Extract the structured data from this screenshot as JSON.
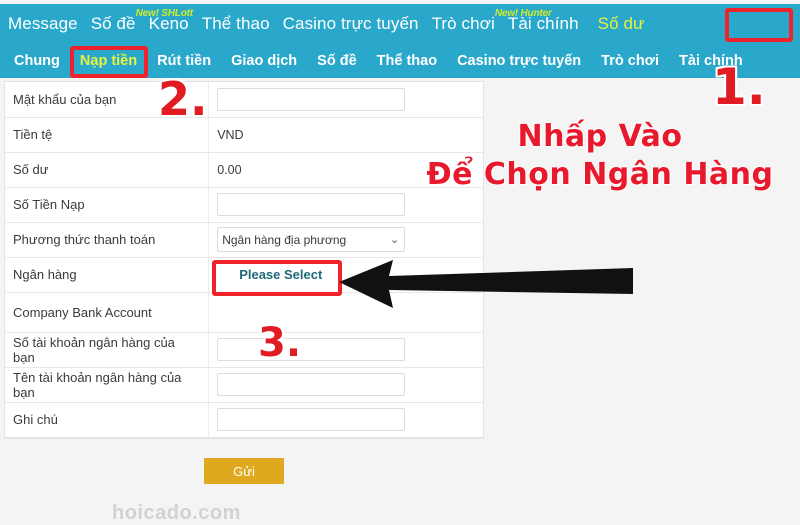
{
  "colors": {
    "nav_bg": "#2aa8cc",
    "nav_text": "#ffffff",
    "nav_active": "#e8f23f",
    "badge": "#cdec2a",
    "annotation_red": "#e8192c",
    "highlight_red": "#f0222a",
    "submit_bg": "#e0a81f",
    "link_teal": "#1f6b7a"
  },
  "top_nav": {
    "items": [
      {
        "label": "Message",
        "badge": "",
        "active": false
      },
      {
        "label": "Số đề",
        "badge": "New! SHLott",
        "active": false
      },
      {
        "label": "Keno",
        "badge": "",
        "active": false
      },
      {
        "label": "Thể thao",
        "badge": "",
        "active": false
      },
      {
        "label": "Casino trực tuyến",
        "badge": "",
        "active": false
      },
      {
        "label": "Trò chơi",
        "badge": "New! Hunter",
        "active": false
      },
      {
        "label": "Tài chính",
        "badge": "",
        "active": false
      },
      {
        "label": "Số dư",
        "badge": "",
        "active": true
      }
    ]
  },
  "sub_nav": {
    "items": [
      {
        "label": "Chung",
        "active": false
      },
      {
        "label": "Nạp tiền",
        "active": true
      },
      {
        "label": "Rút tiền",
        "active": false
      },
      {
        "label": "Giao dịch",
        "active": false
      },
      {
        "label": "Số đề",
        "active": false
      },
      {
        "label": "Thể thao",
        "active": false
      },
      {
        "label": "Casino trực tuyến",
        "active": false
      },
      {
        "label": "Trò chơi",
        "active": false
      },
      {
        "label": "Tài chính",
        "active": false
      }
    ]
  },
  "form": {
    "rows": [
      {
        "label": "Mật khẩu của bạn",
        "type": "input",
        "value": ""
      },
      {
        "label": "Tiền tệ",
        "type": "text",
        "value": "VND"
      },
      {
        "label": "Số dư",
        "type": "text",
        "value": "0.00"
      },
      {
        "label": "Số Tiền Nạp",
        "type": "input",
        "value": ""
      },
      {
        "label": "Phương thức thanh toán",
        "type": "select",
        "value": "Ngân hàng địa phương"
      },
      {
        "label": "Ngân hàng",
        "type": "link",
        "value": "Please Select"
      },
      {
        "label": "Company Bank Account",
        "type": "empty",
        "value": ""
      },
      {
        "label": "Số tài khoản ngân hàng của bạn",
        "type": "input",
        "value": ""
      },
      {
        "label": "Tên tài khoản ngân hàng của bạn",
        "type": "input",
        "value": ""
      },
      {
        "label": "Ghi chú",
        "type": "input",
        "value": ""
      }
    ],
    "submit_label": "Gửi"
  },
  "watermark": "hoicado.com",
  "annotations": {
    "callout_line1": "Nhấp Vào",
    "callout_line2": "Để Chọn Ngân Hàng",
    "step1": "1.",
    "step2": "2.",
    "step3": "3."
  }
}
